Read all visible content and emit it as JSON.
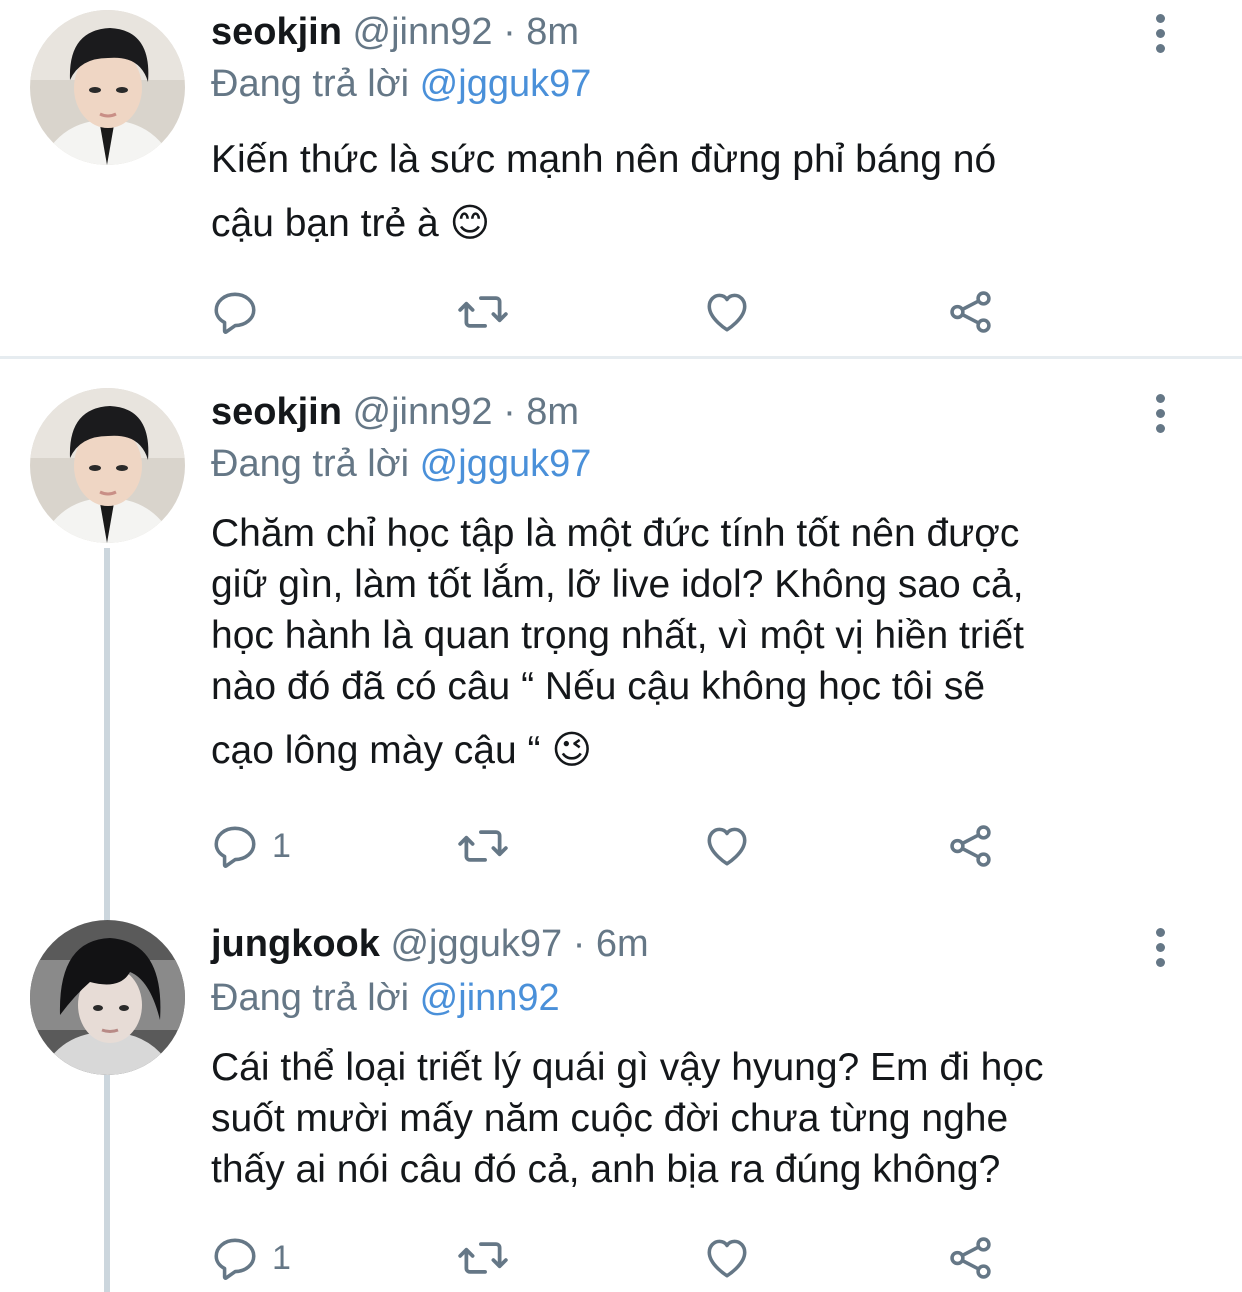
{
  "tweets": [
    {
      "name": "seokjin",
      "handle": "@jinn92",
      "time": "8m",
      "separator": "·",
      "replying_prefix": "Đang trả lời",
      "replying_to": "@jgguk97",
      "lines": [
        "Kiến thức là sức mạnh nên đừng phỉ báng nó",
        "cậu bạn trẻ à 😊"
      ],
      "reply_count": "",
      "avatar_icon": "profile-photo-seokjin"
    },
    {
      "name": "seokjin",
      "handle": "@jinn92",
      "time": "8m",
      "separator": "·",
      "replying_prefix": "Đang trả lời",
      "replying_to": "@jgguk97",
      "lines": [
        "Chăm chỉ học tập là một đức tính tốt nên được",
        "giữ gìn, làm tốt lắm, lỡ live idol? Không sao cả,",
        "học hành là quan trọng nhất, vì một vị hiền triết",
        "nào đó đã có câu “ Nếu cậu không học tôi sẽ",
        "cạo lông mày cậu “ 😉"
      ],
      "reply_count": "1",
      "avatar_icon": "profile-photo-seokjin"
    },
    {
      "name": "jungkook",
      "handle": "@jgguk97",
      "time": "6m",
      "separator": "·",
      "replying_prefix": "Đang trả lời",
      "replying_to": "@jinn92",
      "lines": [
        "Cái thể loại triết lý quái gì vậy hyung? Em đi học",
        "suốt mười mấy năm cuộc đời chưa từng nghe",
        "thấy ai nói câu đó cả, anh bịa ra đúng không?"
      ],
      "reply_count": "1",
      "avatar_icon": "profile-photo-jungkook"
    }
  ],
  "colors": {
    "text": "#14171a",
    "secondary": "#657786",
    "link": "#4a90d9",
    "divider": "#e6ecf0",
    "thread_line": "#ccd6dd"
  },
  "icons": [
    "reply-icon",
    "retweet-icon",
    "like-icon",
    "share-icon",
    "more-options-icon"
  ]
}
